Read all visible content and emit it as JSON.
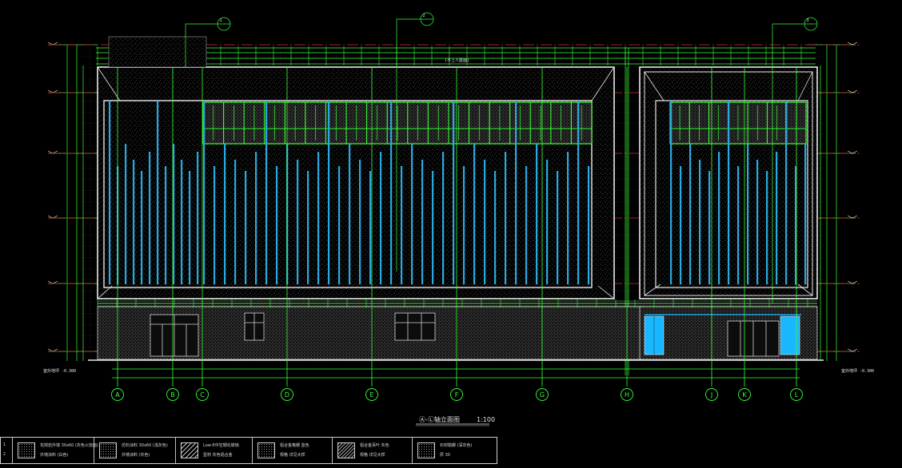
{
  "drawing": {
    "title": "Ⓐ-Ⓛ轴立面图",
    "scale": "1:100",
    "axes": [
      "A",
      "B",
      "C",
      "D",
      "E",
      "F",
      "G",
      "H",
      "J",
      "K",
      "L"
    ],
    "callout_numbers": [
      "1",
      "2",
      "3"
    ],
    "bottom_left_note": "室外地坪 -0.300",
    "bottom_right_note": "室外地坪 -0.300",
    "top_note": "(不上人屋面)"
  },
  "colors": {
    "background": "#000000",
    "axis_green": "#39ff39",
    "red_dash": "#d42a2a",
    "blue_fin": "#2aa9e0",
    "cyan_door": "#19b7ff",
    "white_line": "#e8e8e8"
  },
  "legend": {
    "rows": [
      "1",
      "2"
    ],
    "cells": [
      {
        "icon": "stipple-swatch-icon",
        "line1": "花岗岩外墙 30x60 (灰色火烧面)",
        "line2": "外墙涂料 (白色)"
      },
      {
        "icon": "stipple-swatch-icon",
        "line1": "仿石涂料 30x60 (浅灰色)",
        "line2": "外墙涂料 (灰色)"
      },
      {
        "icon": "hatch-swatch-icon",
        "line1": "Low-E中空钢化玻璃",
        "line2": "型材 灰色铝合金"
      },
      {
        "icon": "stipple-swatch-icon",
        "line1": "铝合金格栅 蓝色",
        "line2": "规格 详见大样"
      },
      {
        "icon": "hatch-swatch-icon",
        "line1": "铝合金百叶 灰色",
        "line2": "规格 详见大样"
      },
      {
        "icon": "stipple-swatch-icon",
        "line1": "石材勒脚 (深灰色)",
        "line2": "厚 30"
      }
    ]
  }
}
